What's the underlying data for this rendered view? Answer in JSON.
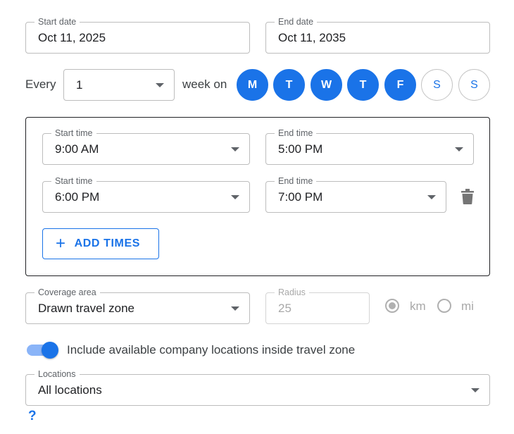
{
  "dates": {
    "start_label": "Start date",
    "start_value": "Oct 11, 2025",
    "end_label": "End date",
    "end_value": "Oct 11, 2035"
  },
  "recurrence": {
    "every_label": "Every",
    "interval_value": "1",
    "unit_label": "week on",
    "days": [
      {
        "label": "M",
        "selected": true
      },
      {
        "label": "T",
        "selected": true
      },
      {
        "label": "W",
        "selected": true
      },
      {
        "label": "T",
        "selected": true
      },
      {
        "label": "F",
        "selected": true
      },
      {
        "label": "S",
        "selected": false
      },
      {
        "label": "S",
        "selected": false
      }
    ]
  },
  "times": [
    {
      "start_label": "Start time",
      "start_value": "9:00 AM",
      "end_label": "End time",
      "end_value": "5:00 PM"
    },
    {
      "start_label": "Start time",
      "start_value": "6:00 PM",
      "end_label": "End time",
      "end_value": "7:00 PM"
    }
  ],
  "add_times_label": "ADD TIMES",
  "coverage": {
    "label": "Coverage area",
    "value": "Drawn travel zone",
    "radius_label": "Radius",
    "radius_value": "25",
    "units": [
      {
        "label": "km",
        "selected": true
      },
      {
        "label": "mi",
        "selected": false
      }
    ]
  },
  "include_toggle": {
    "label": "Include available company locations inside travel zone",
    "on": true
  },
  "locations": {
    "label": "Locations",
    "value": "All locations"
  },
  "help_label": "?",
  "colors": {
    "accent": "#1a73e8",
    "toggle_track": "#8ab4f8",
    "border": "#bdbdbd"
  }
}
